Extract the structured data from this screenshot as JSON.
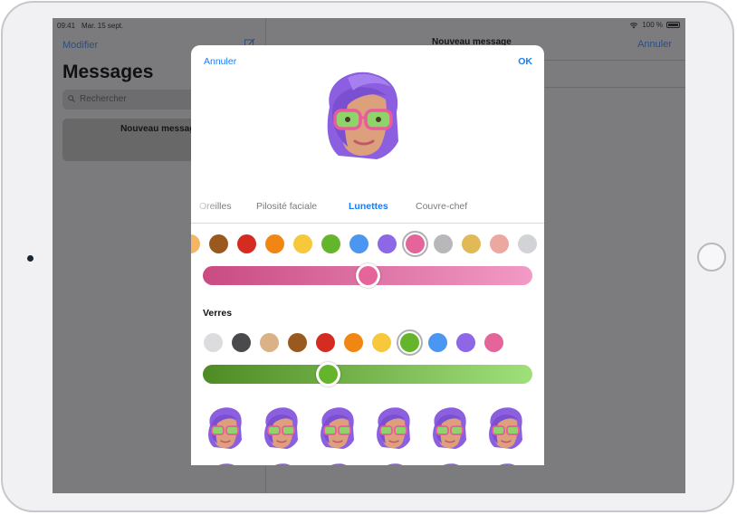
{
  "statusbar": {
    "time": "09:41",
    "date": "Mar. 15 sept.",
    "battery": "100 %"
  },
  "sidebar": {
    "edit_label": "Modifier",
    "title": "Messages",
    "search_placeholder": "Rechercher",
    "card_title": "Nouveau message"
  },
  "conversation": {
    "title": "Nouveau message",
    "cancel_label": "Annuler"
  },
  "sheet": {
    "cancel_label": "Annuler",
    "ok_label": "OK",
    "tabs": [
      {
        "label": "Oreilles",
        "active": false
      },
      {
        "label": "Pilosité faciale",
        "active": false
      },
      {
        "label": "Lunettes",
        "active": true
      },
      {
        "label": "Couvre-chef",
        "active": false
      }
    ],
    "frame_colors": [
      "#f5b563",
      "#9a5a1f",
      "#d42c20",
      "#f08714",
      "#f7c83a",
      "#64b52c",
      "#4b96f1",
      "#8e67e6",
      "#e5659b",
      "#b8b8bb",
      "#e1b956",
      "#eca7a0",
      "#d1d3d7"
    ],
    "frame_selected_index": 8,
    "frame_slider": {
      "value": 0.5,
      "color_start": "#c94b82",
      "color_end": "#f29ac6",
      "knob_color": "#e5659b"
    },
    "lenses_label": "Verres",
    "lens_colors": [
      "#dcdcde",
      "#4a4a4c",
      "#dbb188",
      "#9a5a1f",
      "#d42c20",
      "#f08714",
      "#f7c83a",
      "#64b52c",
      "#4b96f1",
      "#8e67e6",
      "#e5659b"
    ],
    "lens_selected_index": 7,
    "lens_slider": {
      "value": 0.38,
      "color_start": "#4e8b24",
      "color_end": "#a0e07a",
      "knob_color": "#64b52c"
    }
  }
}
